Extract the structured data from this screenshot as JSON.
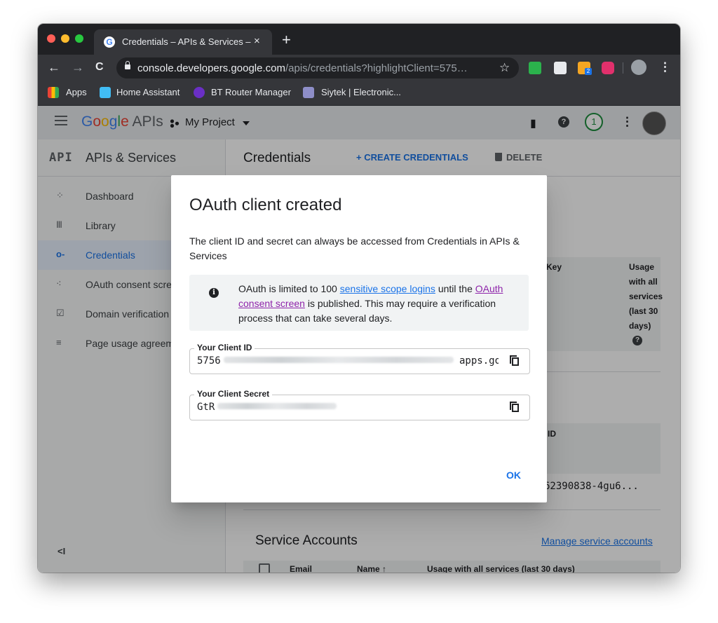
{
  "browser": {
    "tab": {
      "title": "Credentials – APIs & Services –",
      "close": "×"
    },
    "new_tab": "+",
    "nav": {
      "back": "←",
      "forward": "→",
      "reload": "C"
    },
    "address": {
      "host": "console.developers.google.com",
      "path": "/apis/credentials?highlightClient=575…"
    },
    "star": "☆",
    "menu": "⋮",
    "extensions": [
      {
        "icon": "feedly-icon",
        "color": "#2bb24c"
      },
      {
        "icon": "camera-icon",
        "color": "#e8eaed"
      },
      {
        "icon": "rss-icon",
        "color": "#f5a623",
        "badge": "2"
      },
      {
        "icon": "instagram-icon",
        "color": "#e1306c"
      }
    ],
    "bookmarks": [
      {
        "label": "Apps",
        "icon": "apps-grid-icon"
      },
      {
        "label": "Home Assistant",
        "icon": "home-assistant-icon"
      },
      {
        "label": "BT Router Manager",
        "icon": "bt-router-icon"
      },
      {
        "label": "Siytek | Electronic...",
        "icon": "siytek-icon"
      }
    ]
  },
  "appbar": {
    "logo": {
      "google": "Google",
      "apis": " APIs"
    },
    "project": "My Project",
    "notifications": "1",
    "help": "?",
    "gift": "▮",
    "more": "⋮"
  },
  "sidebar": {
    "api_logo": "API",
    "title": "APIs & Services",
    "items": [
      {
        "label": "Dashboard",
        "icon": "⁘"
      },
      {
        "label": "Library",
        "icon": "Ⅲ"
      },
      {
        "label": "Credentials",
        "icon": "o-",
        "active": true
      },
      {
        "label": "OAuth consent scree",
        "icon": "⁖"
      },
      {
        "label": "Domain verification",
        "icon": "☑"
      },
      {
        "label": "Page usage agreeme",
        "icon": "≡"
      }
    ],
    "collapse": "<I"
  },
  "content": {
    "title": "Credentials",
    "create": "+ CREATE CREDENTIALS",
    "delete": "DELETE",
    "api_keys_table": {
      "col_key": "Key",
      "col_usage": "Usage with all services (last 30 days)"
    },
    "oauth_table": {
      "col_id": "ID",
      "client_id_short": "62390838-4gu6..."
    },
    "service_accounts": {
      "title": "Service Accounts",
      "manage_link": "Manage service accounts",
      "columns": [
        "Email",
        "Name ↑",
        "Usage with all services (last 30 days)"
      ]
    }
  },
  "dialog": {
    "title": "OAuth client created",
    "description": "The client ID and secret can always be accessed from Credentials in APIs & Services",
    "info": {
      "t1": "OAuth is limited to 100 ",
      "link1": "sensitive scope logins",
      "t2": " until the ",
      "link2": "OAuth consent screen",
      "t3": " is published. This may require a verification process that can take several days."
    },
    "client_id": {
      "label": "Your Client ID",
      "prefix": "5756",
      "suffix": "apps.go"
    },
    "client_secret": {
      "label": "Your Client Secret",
      "prefix": "GtR"
    },
    "ok": "OK"
  }
}
